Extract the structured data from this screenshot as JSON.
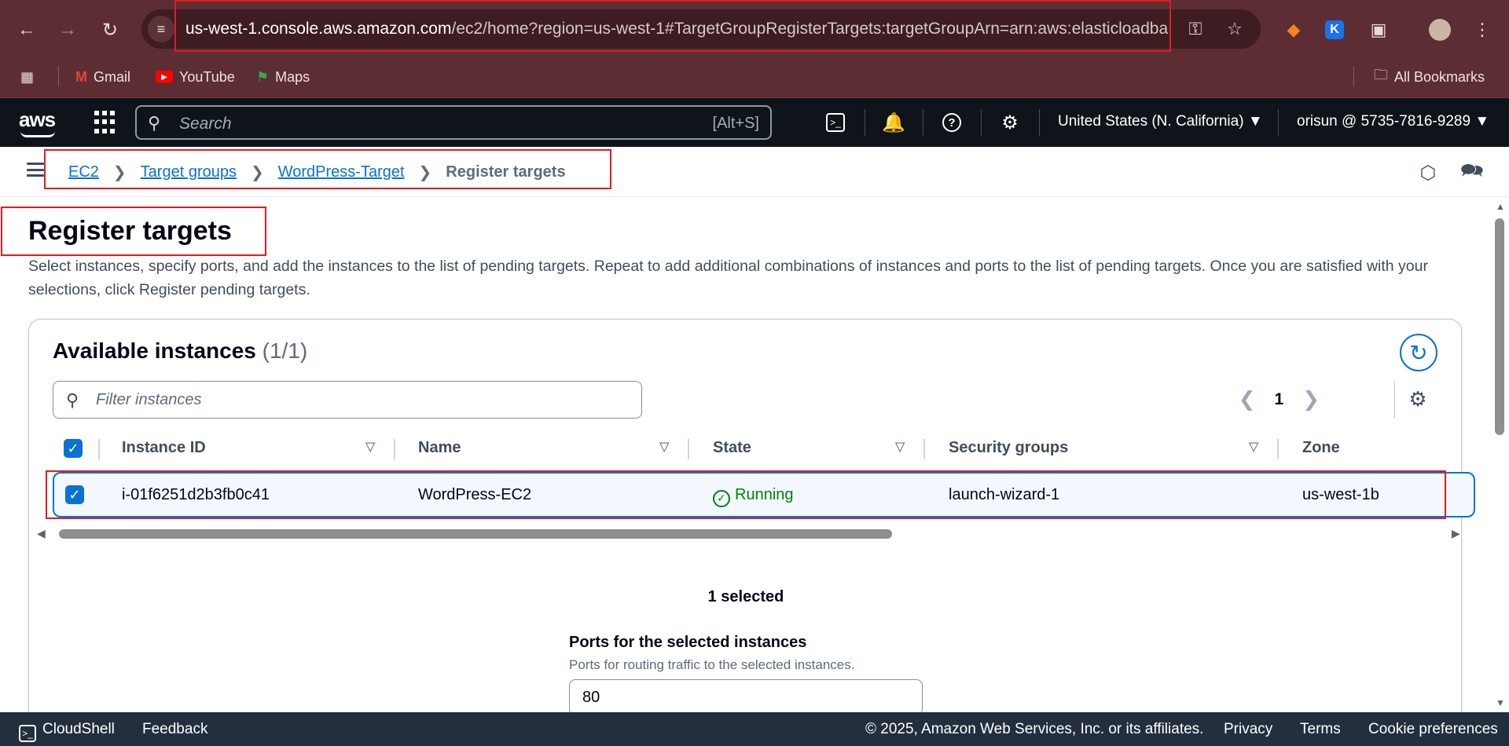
{
  "browser": {
    "url_host": "us-west-1.console.aws.amazon.com",
    "url_rest": "/ec2/home?region=us-west-1#TargetGroupRegisterTargets:targetGroupArn=arn:aws:elasticloadba...",
    "bookmarks": [
      {
        "label": "Gmail",
        "icon": "gmail-icon"
      },
      {
        "label": "YouTube",
        "icon": "youtube-icon"
      },
      {
        "label": "Maps",
        "icon": "maps-icon"
      }
    ],
    "all_bookmarks_label": "All Bookmarks"
  },
  "awsnav": {
    "logo": "aws",
    "search_placeholder": "Search",
    "search_shortcut": "[Alt+S]",
    "region": "United States (N. California)",
    "account": "orisun @ 5735-7816-9289"
  },
  "breadcrumb": {
    "items": [
      "EC2",
      "Target groups",
      "WordPress-Target"
    ],
    "current": "Register targets"
  },
  "page": {
    "title": "Register targets",
    "description": "Select instances, specify ports, and add the instances to the list of pending targets. Repeat to add additional combinations of instances and ports to the list of pending targets. Once you are satisfied with your selections, click Register pending targets."
  },
  "instances": {
    "title": "Available instances",
    "count": "(1/1)",
    "filter_placeholder": "Filter instances",
    "page_number": "1",
    "columns": [
      "Instance ID",
      "Name",
      "State",
      "Security groups",
      "Zone"
    ],
    "rows": [
      {
        "instance_id": "i-01f6251d2b3fb0c41",
        "name": "WordPress-EC2",
        "state": "Running",
        "security_groups": "launch-wizard-1",
        "zone": "us-west-1b",
        "selected": true
      }
    ],
    "selected_text": "1 selected"
  },
  "ports": {
    "label": "Ports for the selected instances",
    "description": "Ports for routing traffic to the selected instances.",
    "value": "80"
  },
  "footer": {
    "cloudshell": "CloudShell",
    "feedback": "Feedback",
    "copyright": "© 2025, Amazon Web Services, Inc. or its affiliates.",
    "privacy": "Privacy",
    "terms": "Terms",
    "cookies": "Cookie preferences"
  },
  "colors": {
    "link": "#0972d3",
    "running": "#037f0c",
    "highlight": "#e21b22",
    "browser_frame": "#5c2d33"
  }
}
